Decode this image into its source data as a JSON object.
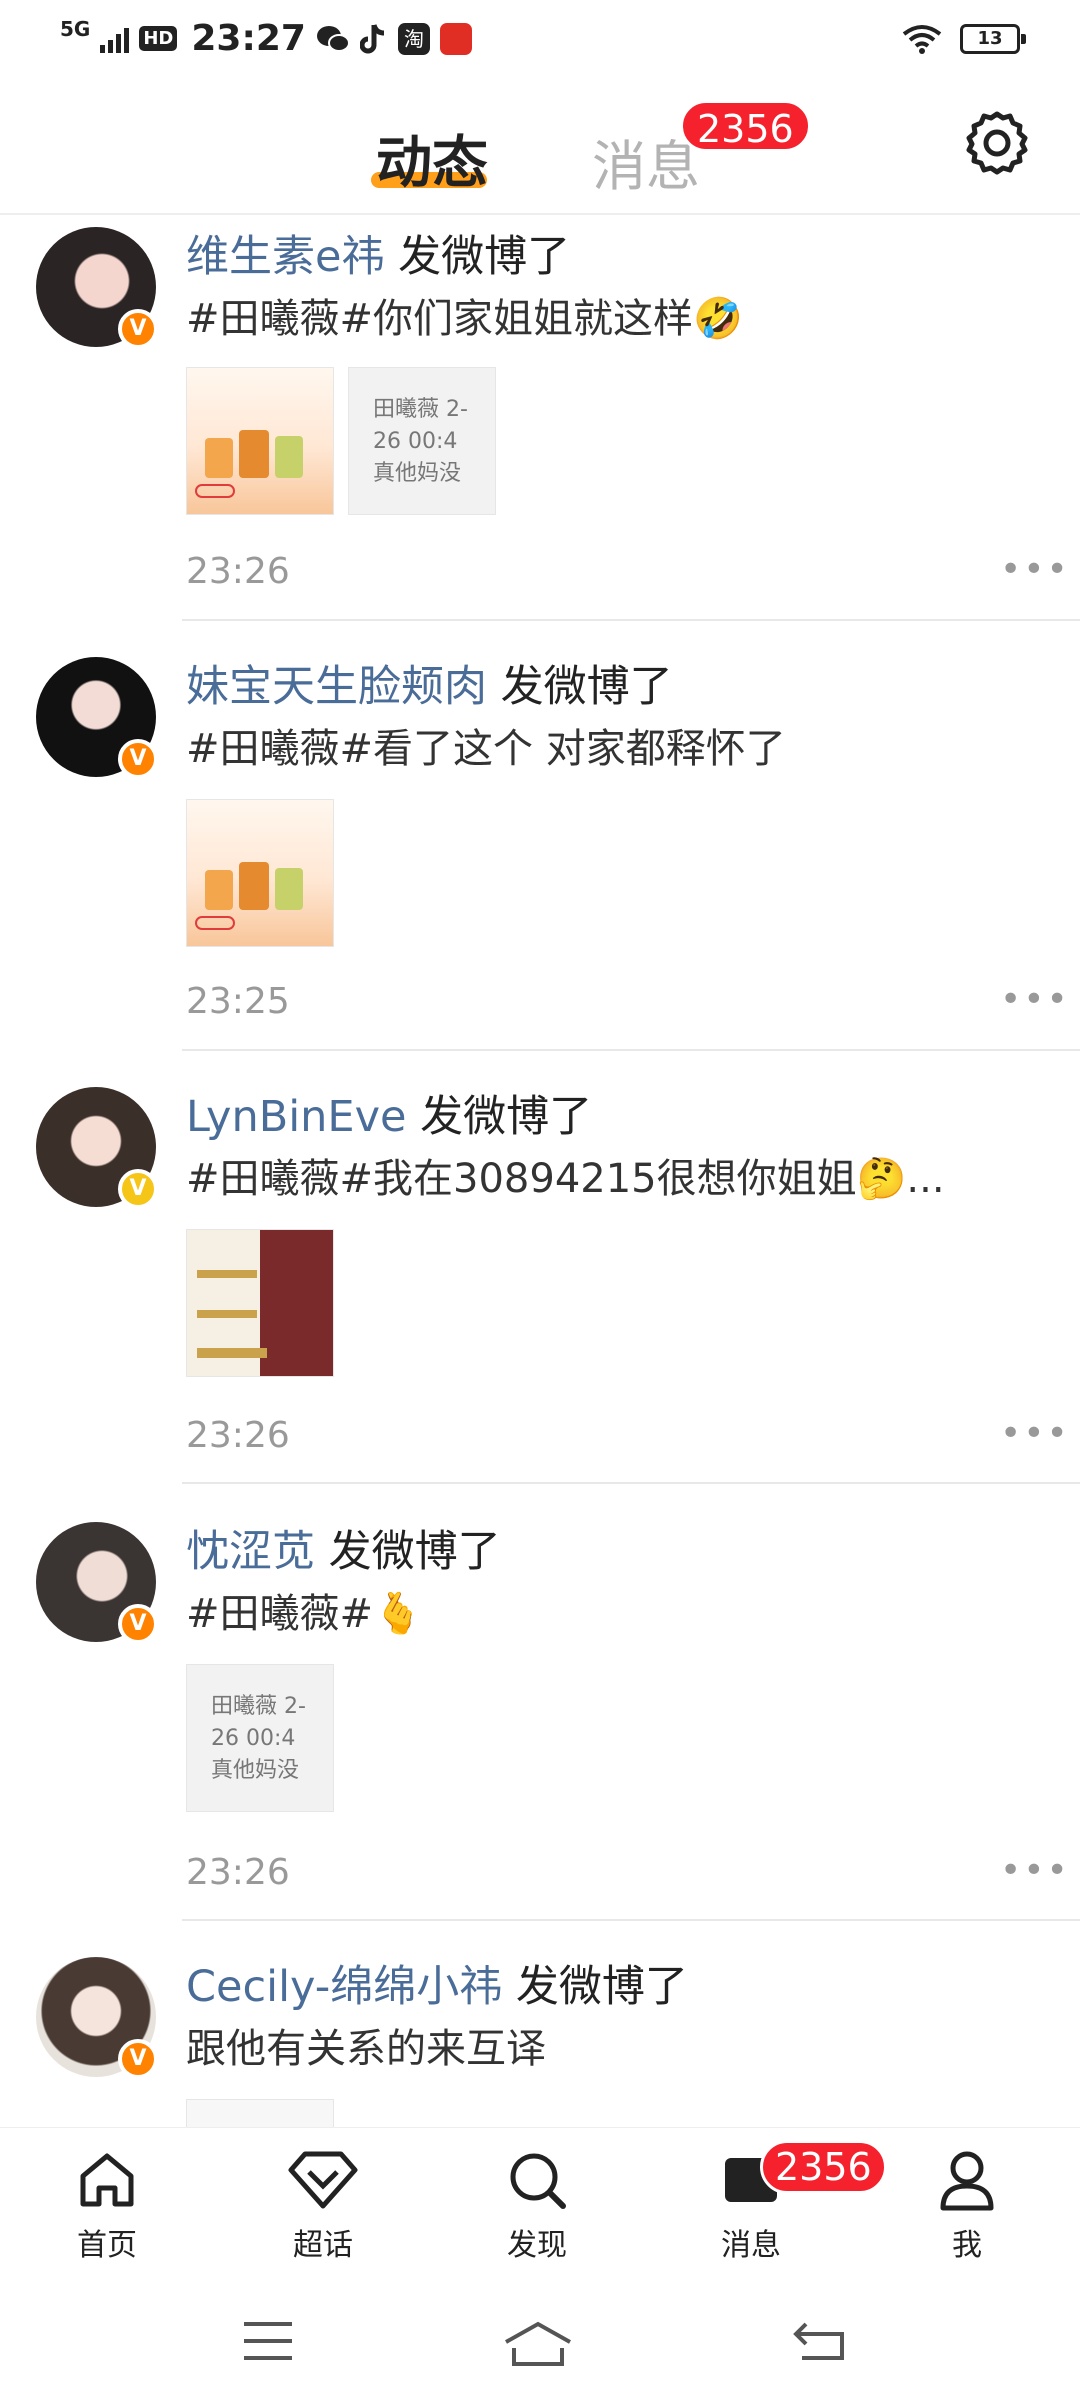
{
  "status_bar": {
    "network": "5G",
    "hd": "HD",
    "time": "23:27",
    "battery": "13",
    "apps": [
      "wechat-icon",
      "tiktok-icon",
      "taobao-icon",
      "pinduoduo-icon"
    ]
  },
  "header": {
    "tab_active": "动态",
    "tab_messages": "消息",
    "messages_badge": "2356",
    "settings_icon": "gear-icon"
  },
  "feed": [
    {
      "username": "维生素e祎",
      "action": "发微博了",
      "text": "#田曦薇#你们家姐姐就这样🤣",
      "time": "23:26",
      "badge": "V",
      "thumb_texts": [
        "",
        "田曦薇 2-26 00:4 真他妈没"
      ]
    },
    {
      "username": "妹宝天生脸颊肉",
      "action": "发微博了",
      "text": "#田曦薇#看了这个 对家都释怀了",
      "time": "23:25",
      "badge": "V"
    },
    {
      "username": "LynBinEve",
      "action": "发微博了",
      "text": "#田曦薇#我在30894215很想你姐姐🤔...",
      "time": "23:26",
      "badge": "V"
    },
    {
      "username": "忱涩苋",
      "action": "发微博了",
      "text": "#田曦薇#🫰",
      "time": "23:26",
      "badge": "V",
      "thumb_texts": [
        "田曦薇 2-26 00:4 真他妈没"
      ]
    },
    {
      "username": "Cecily-绵绵小祎",
      "action": "发微博了",
      "text": "跟他有关系的来互译",
      "badge": "V"
    }
  ],
  "more_label": "•••",
  "bottom_nav": {
    "home": "首页",
    "supertopic": "超话",
    "discover": "发现",
    "messages": "消息",
    "messages_badge": "2356",
    "me": "我"
  },
  "colors": {
    "accent": "#ff9f1a",
    "badge_red": "#f5222d",
    "username_blue": "#4a6c98",
    "verified_orange": "#ff8200"
  }
}
